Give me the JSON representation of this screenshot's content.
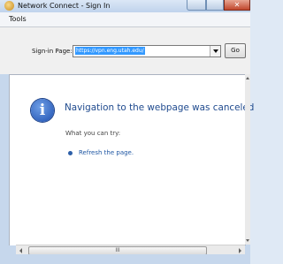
{
  "window": {
    "title": "Network Connect - Sign In",
    "app_icon": "network-connect-icon",
    "caption_buttons": {
      "minimize": "",
      "maximize": "",
      "close": ""
    }
  },
  "menubar": {
    "items": [
      "Tools"
    ]
  },
  "toolbar": {
    "signin_label": "Sign-in Page:",
    "signin_url": "https://vpn.eng.utah.edu/",
    "go_label": "Go"
  },
  "content": {
    "icon": "info-icon",
    "heading": "Navigation to the webpage was canceled",
    "tips_label": "What you can try:",
    "tips": [
      "Refresh the page."
    ]
  },
  "scrollbar": {
    "thumb_grip": "III"
  },
  "colors": {
    "heading": "#1f4a8e",
    "link": "#1f57a3",
    "selection": "#3399ff",
    "frame": "#c6d7ec"
  }
}
